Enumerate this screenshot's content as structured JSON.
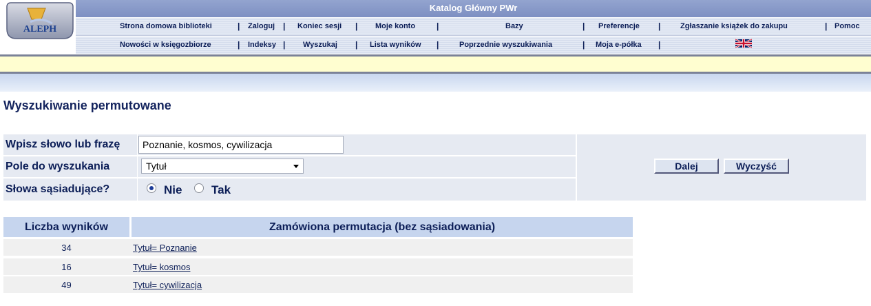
{
  "header": {
    "logo_text": "ALEPH",
    "catalog_title": "Katalog Główny PWr",
    "nav_row1": [
      {
        "label": "Strona domowa biblioteki"
      },
      {
        "label": "Zaloguj"
      },
      {
        "label": "Koniec sesji"
      },
      {
        "label": "Moje konto"
      },
      {
        "label": "Bazy"
      },
      {
        "label": "Preferencje"
      },
      {
        "label": "Zgłaszanie książek do zakupu"
      },
      {
        "label": "Pomoc"
      }
    ],
    "nav_row2": [
      {
        "label": "Nowości w księgozbiorze"
      },
      {
        "label": "Indeksy"
      },
      {
        "label": "Wyszukaj"
      },
      {
        "label": "Lista wyników"
      },
      {
        "label": "Poprzednie wyszukiwania"
      },
      {
        "label": "Moja e-półka"
      }
    ],
    "separator": "|",
    "language_flag": "uk-flag-icon"
  },
  "page_title": "Wyszukiwanie permutowane",
  "form": {
    "query_label": "Wpisz słowo lub frazę",
    "query_value": "Poznanie, kosmos, cywilizacja",
    "field_label": "Pole do wyszukania",
    "field_value": "Tytuł",
    "adjacent_label": "Słowa sąsiadujące?",
    "adjacent_no": "Nie",
    "adjacent_yes": "Tak",
    "adjacent_selected": "Nie",
    "submit_label": "Dalej",
    "clear_label": "Wyczyść"
  },
  "results": {
    "col_count": "Liczba wyników",
    "col_permutation": "Zamówiona permutacja (bez sąsiadowania)",
    "rows": [
      {
        "count": "34",
        "link": "Tytuł= Poznanie"
      },
      {
        "count": "16",
        "link": "Tytuł= kosmos"
      },
      {
        "count": "49",
        "link": "Tytuł= cywilizacja"
      }
    ]
  },
  "colors": {
    "title_bar": "#8c9cca",
    "nav_text": "#0c1e57",
    "yellow_band": "#fffed0",
    "table_header": "#c6d5ee",
    "form_bg": "#e6eaf2"
  }
}
